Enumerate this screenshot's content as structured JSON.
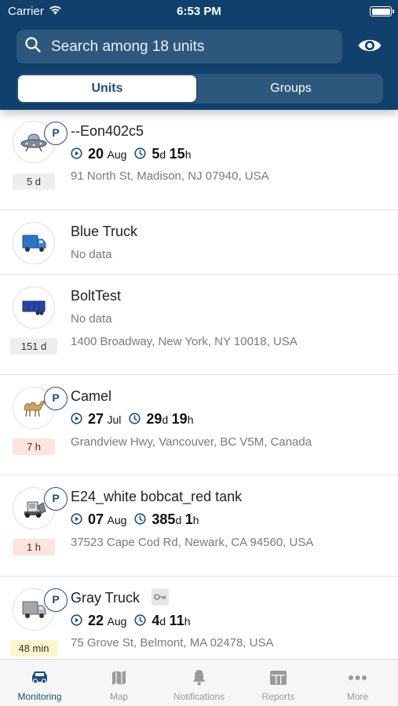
{
  "status_bar": {
    "carrier": "Carrier",
    "time": "6:53 PM"
  },
  "search": {
    "placeholder": "Search among 18 units"
  },
  "segments": {
    "units": "Units",
    "groups": "Groups",
    "selected": "Units"
  },
  "units": [
    {
      "name": "--Eon402c5",
      "parking_badge": "P",
      "age": "5 d",
      "date_day": "20",
      "date_month": "Aug",
      "dur_a": "5",
      "dur_a_unit": "d",
      "dur_b": "15",
      "dur_b_unit": "h",
      "address": "91 North St, Madison, NJ 07940, USA",
      "icon": "ufo-icon"
    },
    {
      "name": "Blue Truck",
      "status": "No data",
      "icon": "blue-truck-icon"
    },
    {
      "name": "BoltTest",
      "status": "No data",
      "age": "151 d",
      "address": "1400 Broadway, New York, NY 10018, USA",
      "icon": "trailer-icon"
    },
    {
      "name": "Camel",
      "parking_badge": "P",
      "age": "7 h",
      "date_day": "27",
      "date_month": "Jul",
      "dur_a": "29",
      "dur_a_unit": "d",
      "dur_b": "19",
      "dur_b_unit": "h",
      "address": "Grandview Hwy, Vancouver, BC V5M, Canada",
      "icon": "camel-icon"
    },
    {
      "name": "E24_white bobcat_red tank",
      "parking_badge": "P",
      "age": "1 h",
      "date_day": "07",
      "date_month": "Aug",
      "dur_a": "385",
      "dur_a_unit": "d",
      "dur_b": "1",
      "dur_b_unit": "h",
      "address": "37523 Cape Cod Rd, Newark, CA 94560, USA",
      "icon": "bobcat-icon"
    },
    {
      "name": "Gray Truck",
      "parking_badge": "P",
      "age": "48 min",
      "date_day": "22",
      "date_month": "Aug",
      "dur_a": "4",
      "dur_a_unit": "d",
      "dur_b": "11",
      "dur_b_unit": "h",
      "address": "75 Grove St, Belmont, MA 02478, USA",
      "icon": "gray-truck-icon"
    }
  ],
  "tabs": [
    {
      "label": "Monitoring",
      "icon": "car-icon",
      "active": true
    },
    {
      "label": "Map",
      "icon": "map-icon"
    },
    {
      "label": "Notifications",
      "icon": "bell-icon"
    },
    {
      "label": "Reports",
      "icon": "reports-icon"
    },
    {
      "label": "More",
      "icon": "more-icon"
    }
  ],
  "colors": {
    "header": "#10406b",
    "accent": "#1d4e7e",
    "age_red": "#fde4dc",
    "age_yellow": "#fff4cc"
  }
}
